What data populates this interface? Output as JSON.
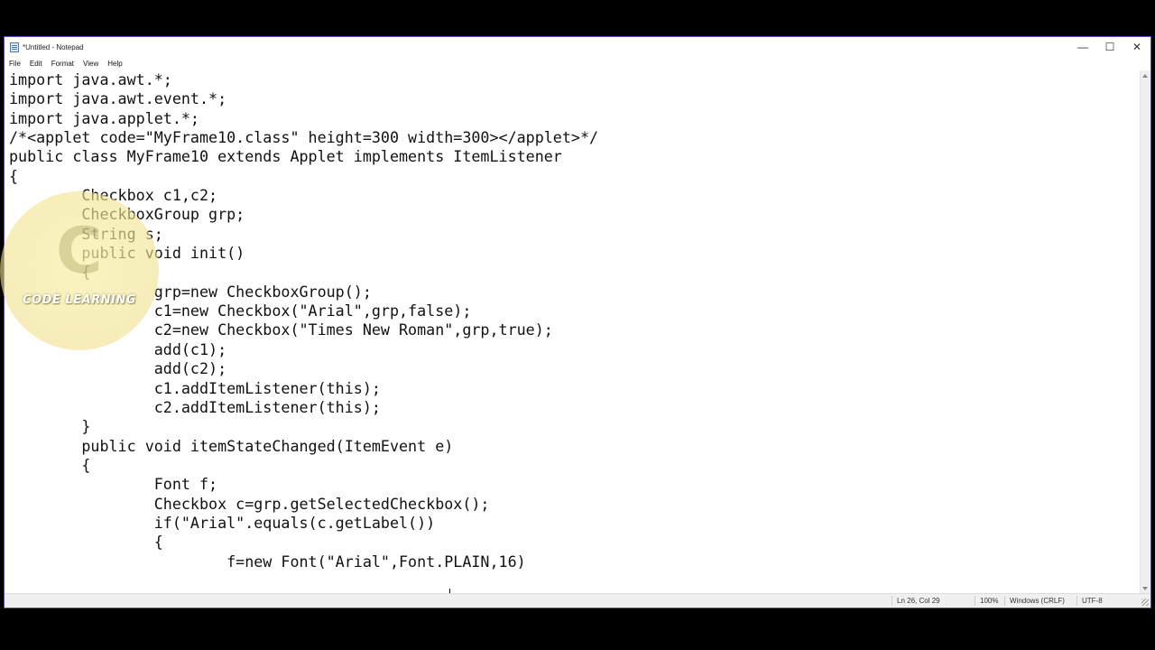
{
  "window": {
    "title": "*Untitled - Notepad",
    "controls": {
      "minimize": "—",
      "maximize": "☐",
      "close": "✕"
    }
  },
  "menu": {
    "items": [
      "File",
      "Edit",
      "Format",
      "View",
      "Help"
    ]
  },
  "editor": {
    "lines": [
      "import java.awt.*;",
      "import java.awt.event.*;",
      "import java.applet.*;",
      "/*<applet code=\"MyFrame10.class\" height=300 width=300></applet>*/",
      "public class MyFrame10 extends Applet implements ItemListener",
      "{",
      "        Checkbox c1,c2;",
      "        CheckboxGroup grp;",
      "        String s;",
      "        public void init()",
      "        {",
      "                grp=new CheckboxGroup();",
      "                c1=new Checkbox(\"Arial\",grp,false);",
      "                c2=new Checkbox(\"Times New Roman\",grp,true);",
      "                add(c1);",
      "                add(c2);",
      "                c1.addItemListener(this);",
      "                c2.addItemListener(this);",
      "        }",
      "        public void itemStateChanged(ItemEvent e)",
      "        {",
      "                Font f;",
      "                Checkbox c=grp.getSelectedCheckbox();",
      "                if(\"Arial\".equals(c.getLabel())",
      "                {",
      "                        f=new Font(\"Arial\",Font.PLAIN,16)"
    ]
  },
  "statusbar": {
    "position": "Ln 26, Col 29",
    "zoom": "100%",
    "line_ending": "Windows (CRLF)",
    "encoding": "UTF-8"
  },
  "watermark": {
    "text": "CODE LEARNING",
    "letter": "C"
  }
}
